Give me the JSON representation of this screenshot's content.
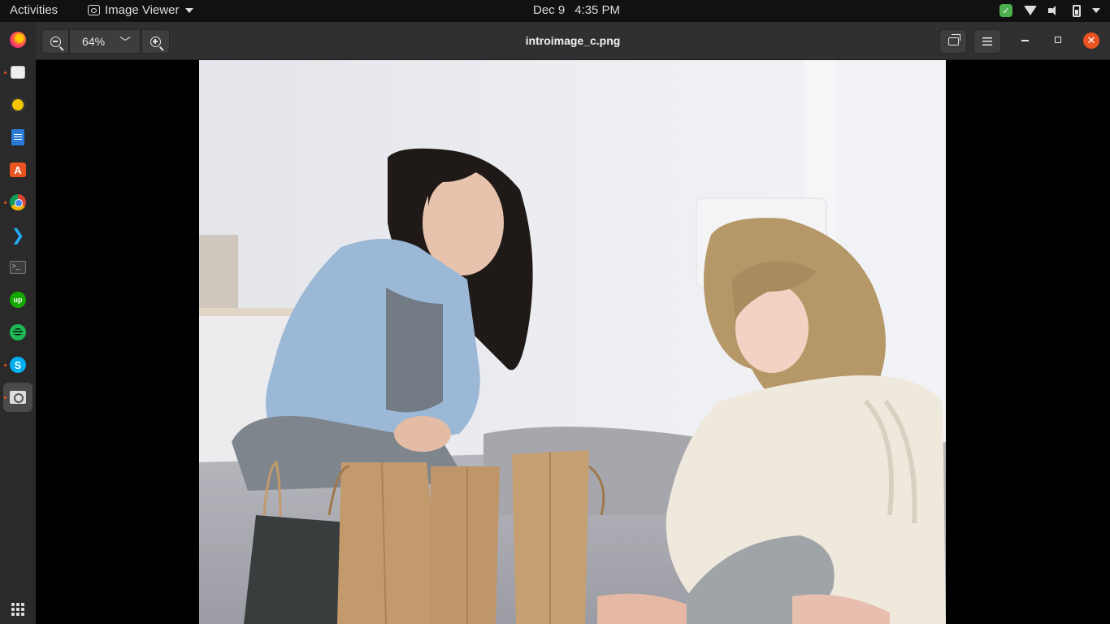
{
  "topbar": {
    "activities_label": "Activities",
    "app_name": "Image Viewer",
    "date": "Dec 9",
    "time": "4:35 PM"
  },
  "dock": {
    "items": [
      {
        "name": "firefox",
        "icon": "firefox-icon"
      },
      {
        "name": "files",
        "icon": "folder-icon"
      },
      {
        "name": "rhythmbox",
        "icon": "music-icon"
      },
      {
        "name": "libreoffice-writer",
        "icon": "document-icon"
      },
      {
        "name": "ubuntu-software",
        "icon": "store-icon"
      },
      {
        "name": "chrome",
        "icon": "chrome-icon"
      },
      {
        "name": "vscode",
        "icon": "vscode-icon"
      },
      {
        "name": "terminal",
        "icon": "terminal-icon"
      },
      {
        "name": "upwork",
        "icon": "upwork-icon"
      },
      {
        "name": "spotify",
        "icon": "spotify-icon"
      },
      {
        "name": "skype",
        "icon": "skype-icon"
      },
      {
        "name": "image-viewer",
        "icon": "image-viewer-icon"
      }
    ],
    "upwork_label": "up",
    "skype_label": "S",
    "store_label": "A",
    "vscode_label": "❯",
    "terminal_label": ">_"
  },
  "viewer": {
    "zoom_level": "64%",
    "zoom_dropdown_glyph": "﹀",
    "file_name": "introimage_c.png",
    "close_glyph": "✕"
  },
  "photo": {
    "description_icon": "photo-image",
    "accent_colors": {
      "wall": "#e9eaee",
      "sofa": "#a9a9b0",
      "cardigan": "#9bb8d6",
      "sweater": "#efe8dc",
      "bag_kraft": "#c29a6c",
      "bag_black": "#3a3d3d"
    }
  },
  "colors": {
    "topbar_bg": "#111111",
    "dock_bg": "#2a2a2a",
    "headerbar_bg": "#303030",
    "close_button": "#e95420"
  }
}
